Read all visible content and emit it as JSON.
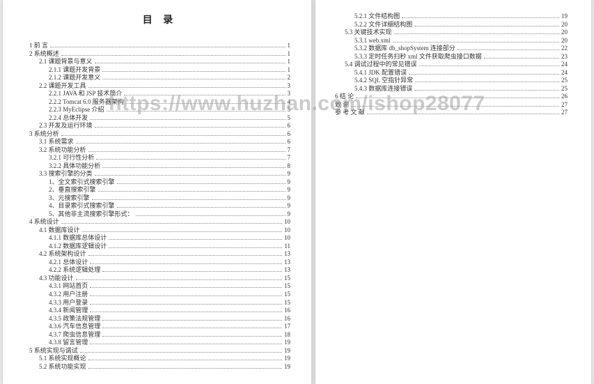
{
  "title": "目 录",
  "watermark": "https://www.huzhan.com/ishop28077",
  "left": [
    {
      "lvl": 1,
      "label": "1 前 言",
      "page": "1"
    },
    {
      "lvl": 1,
      "label": "2 系统概述",
      "page": "1"
    },
    {
      "lvl": 2,
      "label": "2.1 课题背景与意义",
      "page": "1"
    },
    {
      "lvl": 3,
      "label": "2.1.1 课题开发背景",
      "page": "1"
    },
    {
      "lvl": 3,
      "label": "2.1.2 课题开发意义",
      "page": "2"
    },
    {
      "lvl": 2,
      "label": "2.2 课题开发工具",
      "page": "3"
    },
    {
      "lvl": 3,
      "label": "2.2.1 JAVA 和 JSP 技术简介",
      "page": "3"
    },
    {
      "lvl": 3,
      "label": "2.2.2 Tomcat 6.0 服务器架构",
      "page": "4"
    },
    {
      "lvl": 3,
      "label": "2.2.3 MyEclipse 介绍",
      "page": "5"
    },
    {
      "lvl": 3,
      "label": "2.2.4 总体开发",
      "page": "5"
    },
    {
      "lvl": 2,
      "label": "2.3 开发及运行环境",
      "page": "6"
    },
    {
      "lvl": 1,
      "label": "3 系统分析",
      "page": "6"
    },
    {
      "lvl": 2,
      "label": "3.1 系统需求",
      "page": "6"
    },
    {
      "lvl": 2,
      "label": "3.2 系统功能分析",
      "page": "7"
    },
    {
      "lvl": 3,
      "label": "3.2.1 可行性分析",
      "page": "7"
    },
    {
      "lvl": 3,
      "label": "3.2.2 具体功能分析",
      "page": "8"
    },
    {
      "lvl": 2,
      "label": "3.3 搜索引擎的分类",
      "page": "9"
    },
    {
      "lvl": 3,
      "label": "1、全文索引式搜索引擎",
      "page": "9"
    },
    {
      "lvl": 3,
      "label": "2、垂直搜索引擎",
      "page": "9"
    },
    {
      "lvl": 3,
      "label": "3、元搜索引擎",
      "page": "9"
    },
    {
      "lvl": 3,
      "label": "4、目录索引式搜索引擎",
      "page": "9"
    },
    {
      "lvl": 3,
      "label": "5、其他非主流搜索引擎形式：",
      "page": "9"
    },
    {
      "lvl": 1,
      "label": "4 系统设计",
      "page": "10"
    },
    {
      "lvl": 2,
      "label": "4.1 数据库设计",
      "page": "10"
    },
    {
      "lvl": 3,
      "label": "4.1.1 数据库总体设计",
      "page": "10"
    },
    {
      "lvl": 3,
      "label": "4.1.2 数据库逻辑设计",
      "page": "11"
    },
    {
      "lvl": 2,
      "label": "4.2 系统架构设计",
      "page": "13"
    },
    {
      "lvl": 3,
      "label": "4.2.1 总体设计",
      "page": "13"
    },
    {
      "lvl": 3,
      "label": "4.2.2 系统逻辑处理",
      "page": "13"
    },
    {
      "lvl": 2,
      "label": "4.3 功能设计",
      "page": "15"
    },
    {
      "lvl": 3,
      "label": "4.3.1 网站首页",
      "page": "15"
    },
    {
      "lvl": 3,
      "label": "4.3.2 用户注册",
      "page": "15"
    },
    {
      "lvl": 3,
      "label": "4.3.3 用户登录",
      "page": "15"
    },
    {
      "lvl": 3,
      "label": "4.3.4 新闻管理",
      "page": "16"
    },
    {
      "lvl": 3,
      "label": "4.3.5 政策法规管理",
      "page": "16"
    },
    {
      "lvl": 3,
      "label": "4.3.6 汽车信息管理",
      "page": "17"
    },
    {
      "lvl": 3,
      "label": "4.3.7 爬虫信息管理",
      "page": "18"
    },
    {
      "lvl": 3,
      "label": "4.3.8 留言管理",
      "page": "19"
    },
    {
      "lvl": 1,
      "label": "5 系统实现与调试",
      "page": "19"
    },
    {
      "lvl": 2,
      "label": "5.1 系统实现概论",
      "page": "19"
    },
    {
      "lvl": 2,
      "label": "5.2 系统功能实现",
      "page": "19"
    }
  ],
  "right": [
    {
      "lvl": 3,
      "label": "5.2.1 文件结构图",
      "page": "19"
    },
    {
      "lvl": 3,
      "label": "5.2.2 文件详细结构图",
      "page": "20"
    },
    {
      "lvl": 2,
      "label": "5.3 关键技术实现",
      "page": "20"
    },
    {
      "lvl": 3,
      "label": "5.3.1 web.xml",
      "page": "20"
    },
    {
      "lvl": 3,
      "label": "5.3.2 数据库 db_shopSystem 连接部分",
      "page": "22"
    },
    {
      "lvl": 3,
      "label": "5.3.3 定时任务扫秒 xml 文件获取爬虫接口数据",
      "page": "23"
    },
    {
      "lvl": 2,
      "label": "5.4 调试过程中的常见错误",
      "page": "24"
    },
    {
      "lvl": 3,
      "label": "5.4.1 JDK 配置错误",
      "page": "24"
    },
    {
      "lvl": 3,
      "label": "5.4.2 SQL 空指针异常",
      "page": "25"
    },
    {
      "lvl": 3,
      "label": "5.4.3 数据库连接错误",
      "page": "25"
    },
    {
      "lvl": 1,
      "label": "6 结 论",
      "page": "26"
    },
    {
      "lvl": 1,
      "label": "致  谢",
      "page": "27"
    },
    {
      "lvl": 1,
      "label": "参 考 文 献",
      "page": "27"
    }
  ]
}
